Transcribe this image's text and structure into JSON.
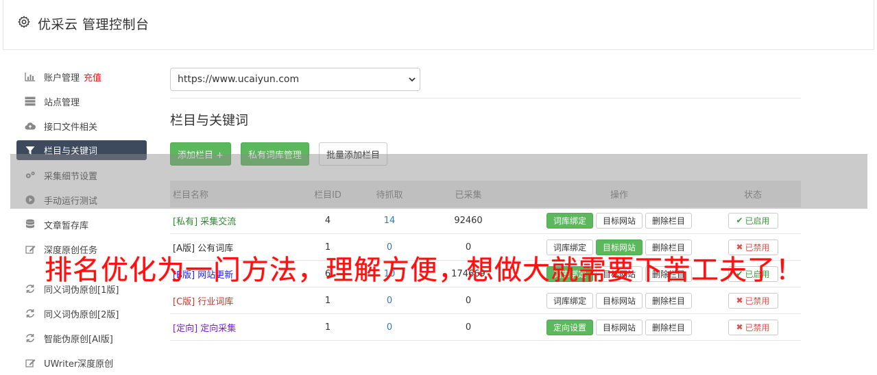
{
  "header": {
    "title": "优采云 管理控制台"
  },
  "sidebar": {
    "items": [
      {
        "label": "账户管理",
        "extra": "充值",
        "icon": "bar-chart-icon"
      },
      {
        "label": "站点管理",
        "icon": "server-icon"
      },
      {
        "label": "接口文件相关",
        "icon": "cloud-upload-icon"
      },
      {
        "label": "栏目与关键词",
        "icon": "filter-icon",
        "active": true
      },
      {
        "label": "采集细节设置",
        "icon": "cogs-icon"
      },
      {
        "label": "手动运行测试",
        "icon": "play-circle-icon"
      },
      {
        "label": "文章暂存库",
        "icon": "database-icon"
      },
      {
        "label": "深度原创任务",
        "icon": "edit-icon"
      },
      {
        "label": "同义词伪原创[1版]",
        "icon": "refresh-icon"
      },
      {
        "label": "同义词伪原创[2版]",
        "icon": "refresh-icon"
      },
      {
        "label": "智能伪原创[AI版]",
        "icon": "refresh-icon"
      },
      {
        "label": "UWriter深度原创",
        "icon": "edit-icon"
      }
    ]
  },
  "main": {
    "site_select": "https://www.ucaiyun.com",
    "section_title": "栏目与关键词",
    "buttons": {
      "add": "添加栏目 +",
      "private": "私有词库管理",
      "batch": "批量添加栏目"
    }
  },
  "table": {
    "headers": {
      "name": "栏目名称",
      "id": "栏目ID",
      "wait": "待抓取",
      "done": "已采集",
      "ops": "操作",
      "state": "状态"
    },
    "rows": [
      {
        "prefix": "[私有]",
        "name": "采集交流",
        "id": "4",
        "wait": "14",
        "done": "92460",
        "op1": "词库绑定",
        "op1_green": true,
        "op2": "目标网站",
        "op2_green": false,
        "op3": "删除栏目",
        "state": "已启用",
        "enabled": true,
        "color": "#2a8a2a"
      },
      {
        "prefix": "[A版]",
        "name": "公有词库",
        "id": "1",
        "wait": "0",
        "done": "0",
        "op1": "词库绑定",
        "op1_green": false,
        "op2": "目标网站",
        "op2_green": true,
        "op3": "删除栏目",
        "state": "已禁用",
        "enabled": false,
        "color": "#333333"
      },
      {
        "prefix": "[B版]",
        "name": "网站更新",
        "id": "6",
        "wait": "10",
        "done": "174669",
        "op1": "词库绑定",
        "op1_green": true,
        "op2": "目标网站",
        "op2_green": false,
        "op3": "删除栏目",
        "state": "已启用",
        "enabled": true,
        "color": "#1a1aff"
      },
      {
        "prefix": "[C版]",
        "name": "行业词库",
        "id": "1",
        "wait": "0",
        "done": "0",
        "op1": "词库绑定",
        "op1_green": false,
        "op2": "目标网站",
        "op2_green": false,
        "op3": "删除栏目",
        "state": "已禁用",
        "enabled": false,
        "color": "#c0392b"
      },
      {
        "prefix": "[定向]",
        "name": "定向采集",
        "id": "1",
        "wait": "0",
        "done": "0",
        "op1": "定向设置",
        "op1_green": true,
        "op2": "目标网站",
        "op2_green": false,
        "op3": "删除栏目",
        "state": "已禁用",
        "enabled": false,
        "color": "#7b1fd6"
      }
    ]
  },
  "banner": "排名优化为一门方法，理解方便，想做大就需要下苦工夫了！"
}
